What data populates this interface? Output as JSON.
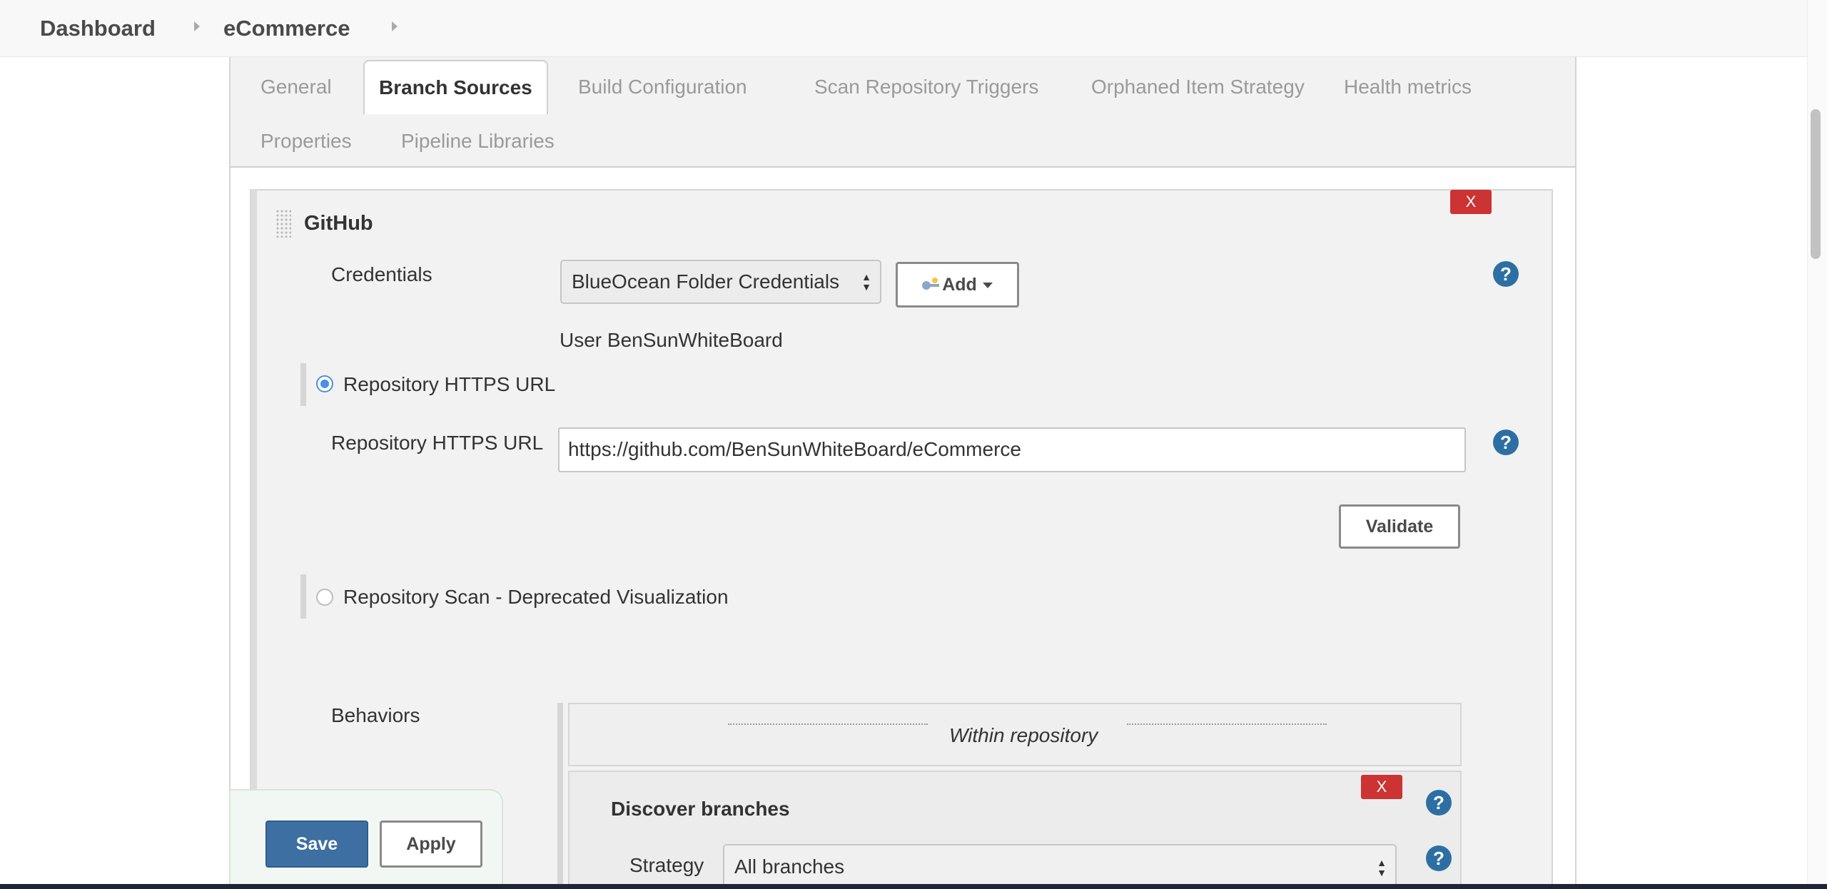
{
  "breadcrumb": {
    "items": [
      "Dashboard",
      "eCommerce"
    ]
  },
  "tabs": [
    {
      "label": "General",
      "active": false
    },
    {
      "label": "Branch Sources",
      "active": true
    },
    {
      "label": "Build Configuration",
      "active": false
    },
    {
      "label": "Scan Repository Triggers",
      "active": false
    },
    {
      "label": "Orphaned Item Strategy",
      "active": false
    },
    {
      "label": "Health metrics",
      "active": false
    },
    {
      "label": "Properties",
      "active": false
    },
    {
      "label": "Pipeline Libraries",
      "active": false
    }
  ],
  "github": {
    "title": "GitHub",
    "delete_label": "X",
    "credentials_label": "Credentials",
    "credentials_value": "BlueOcean Folder Credentials",
    "add_label": "Add",
    "user_text": "User BenSunWhiteBoard",
    "radio_https_label": "Repository HTTPS URL",
    "radio_https_checked": true,
    "https_url_label": "Repository HTTPS URL",
    "https_url_value": "https://github.com/BenSunWhiteBoard/eCommerce",
    "validate_label": "Validate",
    "radio_scan_label": "Repository Scan - Deprecated Visualization",
    "radio_scan_checked": false,
    "help_label": "?"
  },
  "behaviors": {
    "label": "Behaviors",
    "within_header": "Within repository",
    "discover_title": "Discover branches",
    "discover_delete_label": "X",
    "strategy_label": "Strategy",
    "strategy_value": "All branches"
  },
  "actions": {
    "save_label": "Save",
    "apply_label": "Apply"
  },
  "colors": {
    "save_button": "#3d6fa3",
    "delete_button": "#cc3333",
    "help_icon": "#2d6fa3",
    "radio_selected": "#4a90e2"
  },
  "icons": [
    "chevron-right-icon",
    "drag-handle-icon",
    "key-icon",
    "caret-down-icon",
    "help-icon",
    "select-arrows-icon"
  ]
}
